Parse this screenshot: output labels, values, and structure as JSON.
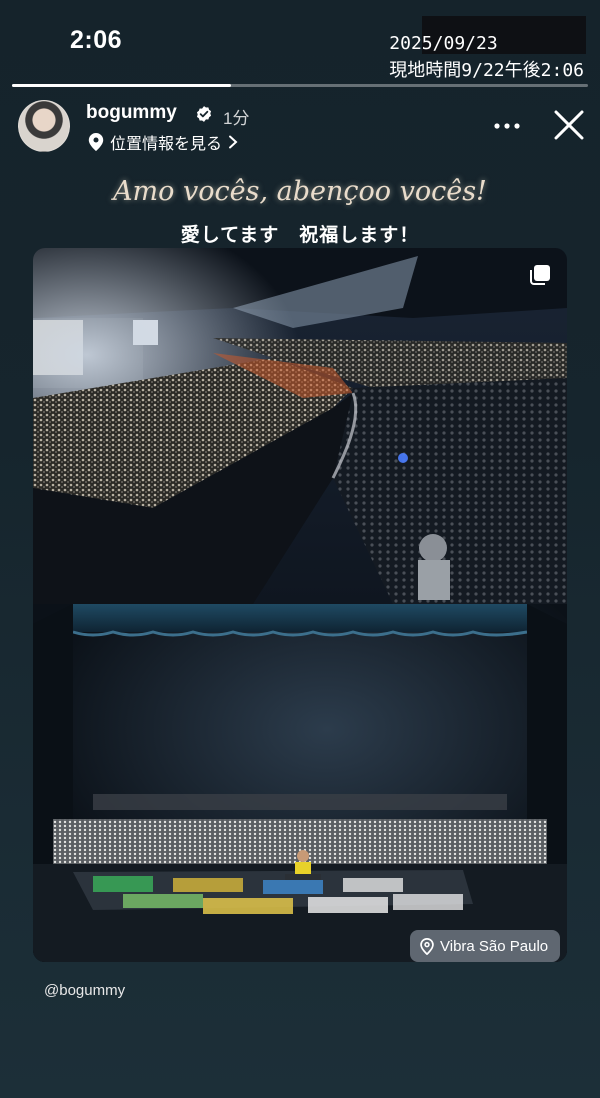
{
  "status_bar": {
    "time": "2:06",
    "date": "2025/09/23",
    "local_time": "現地時間9/22午後2:06"
  },
  "story": {
    "progress": 0.38,
    "username": "bogummy",
    "verified": true,
    "time_ago": "1分",
    "location_link": "位置情報を見る",
    "title_pt": "Amo vocês, abençoo vocês!",
    "title_jp": "愛してます　祝福します！",
    "location_sticker": "Vibra São Paulo",
    "mention": "@bogummy"
  },
  "icons": {
    "verified": "verified-badge-icon",
    "location": "location-pin-icon",
    "chevron": "chevron-right-icon",
    "more": "more-horizontal-icon",
    "close": "close-icon",
    "multi": "multi-photo-icon"
  },
  "colors": {
    "background": "#16252d",
    "verified": "#ffffff",
    "sticker_bg": "#7a8590"
  }
}
